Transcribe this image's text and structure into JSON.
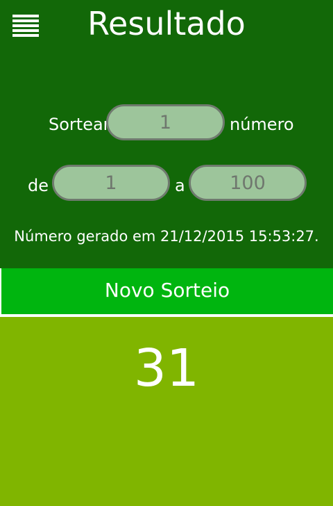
{
  "header": {
    "menu_icon": "hamburger-menu-icon",
    "title": "Resultado"
  },
  "form": {
    "sortear_label": "Sortear",
    "count_value": "1",
    "numero_label": "número",
    "de_label": "de",
    "min_value": "1",
    "a_label": "a",
    "max_value": "100"
  },
  "status": {
    "generated_text": "Número gerado em 21/12/2015 15:53:27."
  },
  "actions": {
    "new_draw_label": "Novo Sorteio"
  },
  "result": {
    "number": "31"
  },
  "colors": {
    "header_bg": "#126808",
    "button_bg": "#00b50f",
    "result_bg": "#80b500",
    "pill_bg": "#9dc59b"
  }
}
